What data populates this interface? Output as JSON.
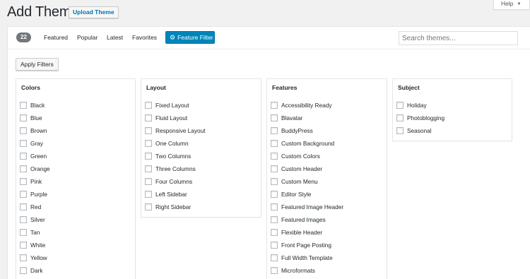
{
  "header": {
    "title": "Add Themes",
    "upload_label": "Upload Theme",
    "help_label": "Help",
    "help_caret": "▼"
  },
  "filter_bar": {
    "count": "22",
    "tabs": [
      "Featured",
      "Popular",
      "Latest",
      "Favorites"
    ],
    "feature_filter_label": "Feature Filter",
    "feature_filter_icon": "gear-icon",
    "search_placeholder": "Search themes...",
    "search_value": ""
  },
  "apply_filters_label": "Apply Filters",
  "groups": [
    {
      "title": "Colors",
      "options": [
        "Black",
        "Blue",
        "Brown",
        "Gray",
        "Green",
        "Orange",
        "Pink",
        "Purple",
        "Red",
        "Silver",
        "Tan",
        "White",
        "Yellow",
        "Dark"
      ]
    },
    {
      "title": "Layout",
      "options": [
        "Fixed Layout",
        "Fluid Layout",
        "Responsive Layout",
        "One Column",
        "Two Columns",
        "Three Columns",
        "Four Columns",
        "Left Sidebar",
        "Right Sidebar"
      ]
    },
    {
      "title": "Features",
      "options": [
        "Accessibility Ready",
        "Blavatar",
        "BuddyPress",
        "Custom Background",
        "Custom Colors",
        "Custom Header",
        "Custom Menu",
        "Editor Style",
        "Featured Image Header",
        "Featured Images",
        "Flexible Header",
        "Front Page Posting",
        "Full Width Template",
        "Microformats"
      ]
    },
    {
      "title": "Subject",
      "options": [
        "Holiday",
        "Photoblogging",
        "Seasonal"
      ]
    }
  ],
  "colors": {
    "accent": "#0085ba",
    "link": "#0073aa",
    "count_badge": "#72777c"
  }
}
